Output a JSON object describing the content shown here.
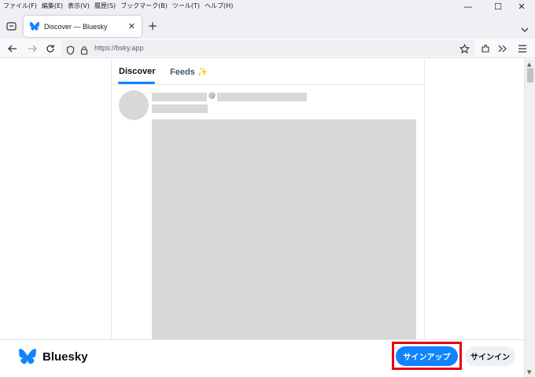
{
  "menubar": {
    "items": [
      "ファイル(F)",
      "編集(E)",
      "表示(V)",
      "履歴(S)",
      "ブックマーク(B)",
      "ツール(T)",
      "ヘルプ(H)"
    ]
  },
  "window_controls": {
    "minimize": "—",
    "maximize": "☐",
    "close": "✕"
  },
  "tab": {
    "title": "Discover — Bluesky",
    "close": "✕"
  },
  "newtab": "+",
  "navbar": {
    "url": "https://bsky.app"
  },
  "feed_tabs": {
    "discover": "Discover",
    "feeds": "Feeds",
    "feeds_emoji": "✨"
  },
  "post": {
    "at_symbol": "@"
  },
  "bottombar": {
    "brand": "Bluesky",
    "signup": "サインアップ",
    "signin": "サインイン"
  },
  "colors": {
    "accent": "#1083fe",
    "highlight": "#e60012",
    "skeleton": "#d8d8d8"
  }
}
